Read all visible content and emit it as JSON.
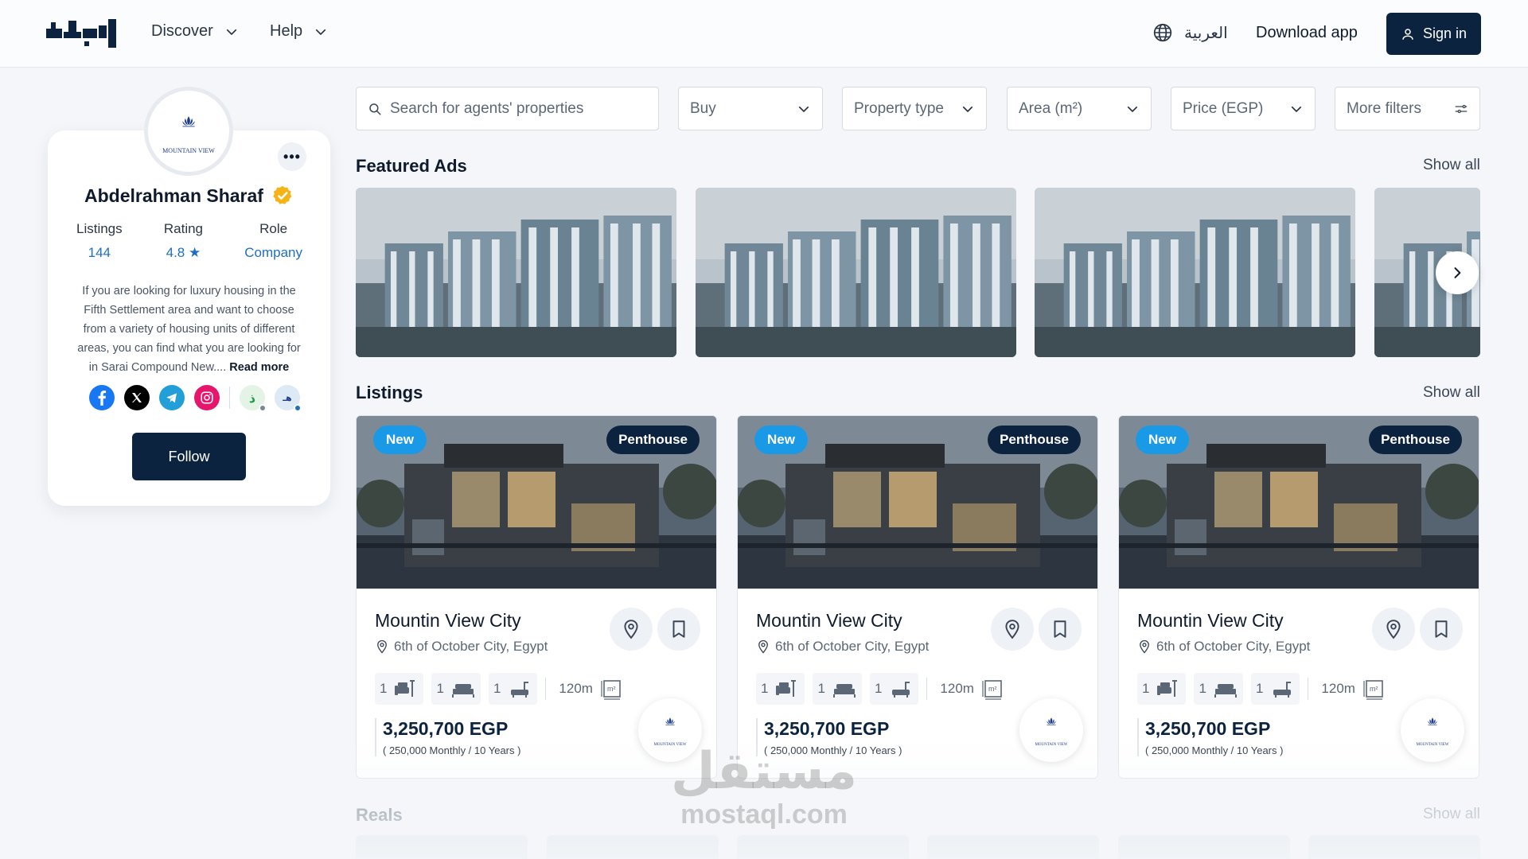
{
  "header": {
    "nav": [
      {
        "label": "Discover"
      },
      {
        "label": "Help"
      }
    ],
    "language_label": "العربية",
    "download_label": "Download app",
    "signin_label": "Sign in"
  },
  "profile": {
    "name": "Abdelrahman Sharaf",
    "logo_text": "MOUNTAIN VIEW",
    "stats": [
      {
        "label": "Listings",
        "value": "144"
      },
      {
        "label": "Rating",
        "value": "4.8 ★"
      },
      {
        "label": "Role",
        "value": "Company"
      }
    ],
    "bio": "If you are looking for luxury housing in the Fifth Settlement area and want to choose from a variety of housing units of different areas, you can find what you are looking for in Sarai Compound New....",
    "read_more": "Read more",
    "socials": [
      "facebook-icon",
      "x-icon",
      "telegram-icon",
      "instagram-icon",
      "app-icon-1",
      "app-icon-2"
    ],
    "follow_label": "Follow"
  },
  "filters": {
    "search_placeholder": "Search for agents' properties",
    "buy": "Buy",
    "property_type": "Property type",
    "area": "Area (m²)",
    "price": "Price (EGP)",
    "more": "More filters"
  },
  "featured": {
    "title": "Featured Ads",
    "show_all": "Show all"
  },
  "listings": {
    "title": "Listings",
    "show_all": "Show all",
    "items": [
      {
        "badge_new": "New",
        "badge_type": "Penthouse",
        "title": "Mountin View City",
        "location": "6th of October City, Egypt",
        "rooms": "1",
        "beds": "1",
        "baths": "1",
        "area": "120m",
        "price": "3,250,700 EGP",
        "monthly": "( 250,000 Monthly / 10 Years )"
      },
      {
        "badge_new": "New",
        "badge_type": "Penthouse",
        "title": "Mountin View City",
        "location": "6th of October City, Egypt",
        "rooms": "1",
        "beds": "1",
        "baths": "1",
        "area": "120m",
        "price": "3,250,700 EGP",
        "monthly": "( 250,000 Monthly / 10 Years )"
      },
      {
        "badge_new": "New",
        "badge_type": "Penthouse",
        "title": "Mountin View City",
        "location": "6th of October City, Egypt",
        "rooms": "1",
        "beds": "1",
        "baths": "1",
        "area": "120m",
        "price": "3,250,700 EGP",
        "monthly": "( 250,000 Monthly / 10 Years )"
      }
    ]
  },
  "reels": {
    "title": "Reals",
    "show_all": "Show all"
  },
  "watermark": {
    "arabic": "مستقل",
    "latin": "mostaql.com"
  },
  "colors": {
    "primary": "#0c2340",
    "accent": "#1a9ae6",
    "link": "#1d6fc4"
  }
}
